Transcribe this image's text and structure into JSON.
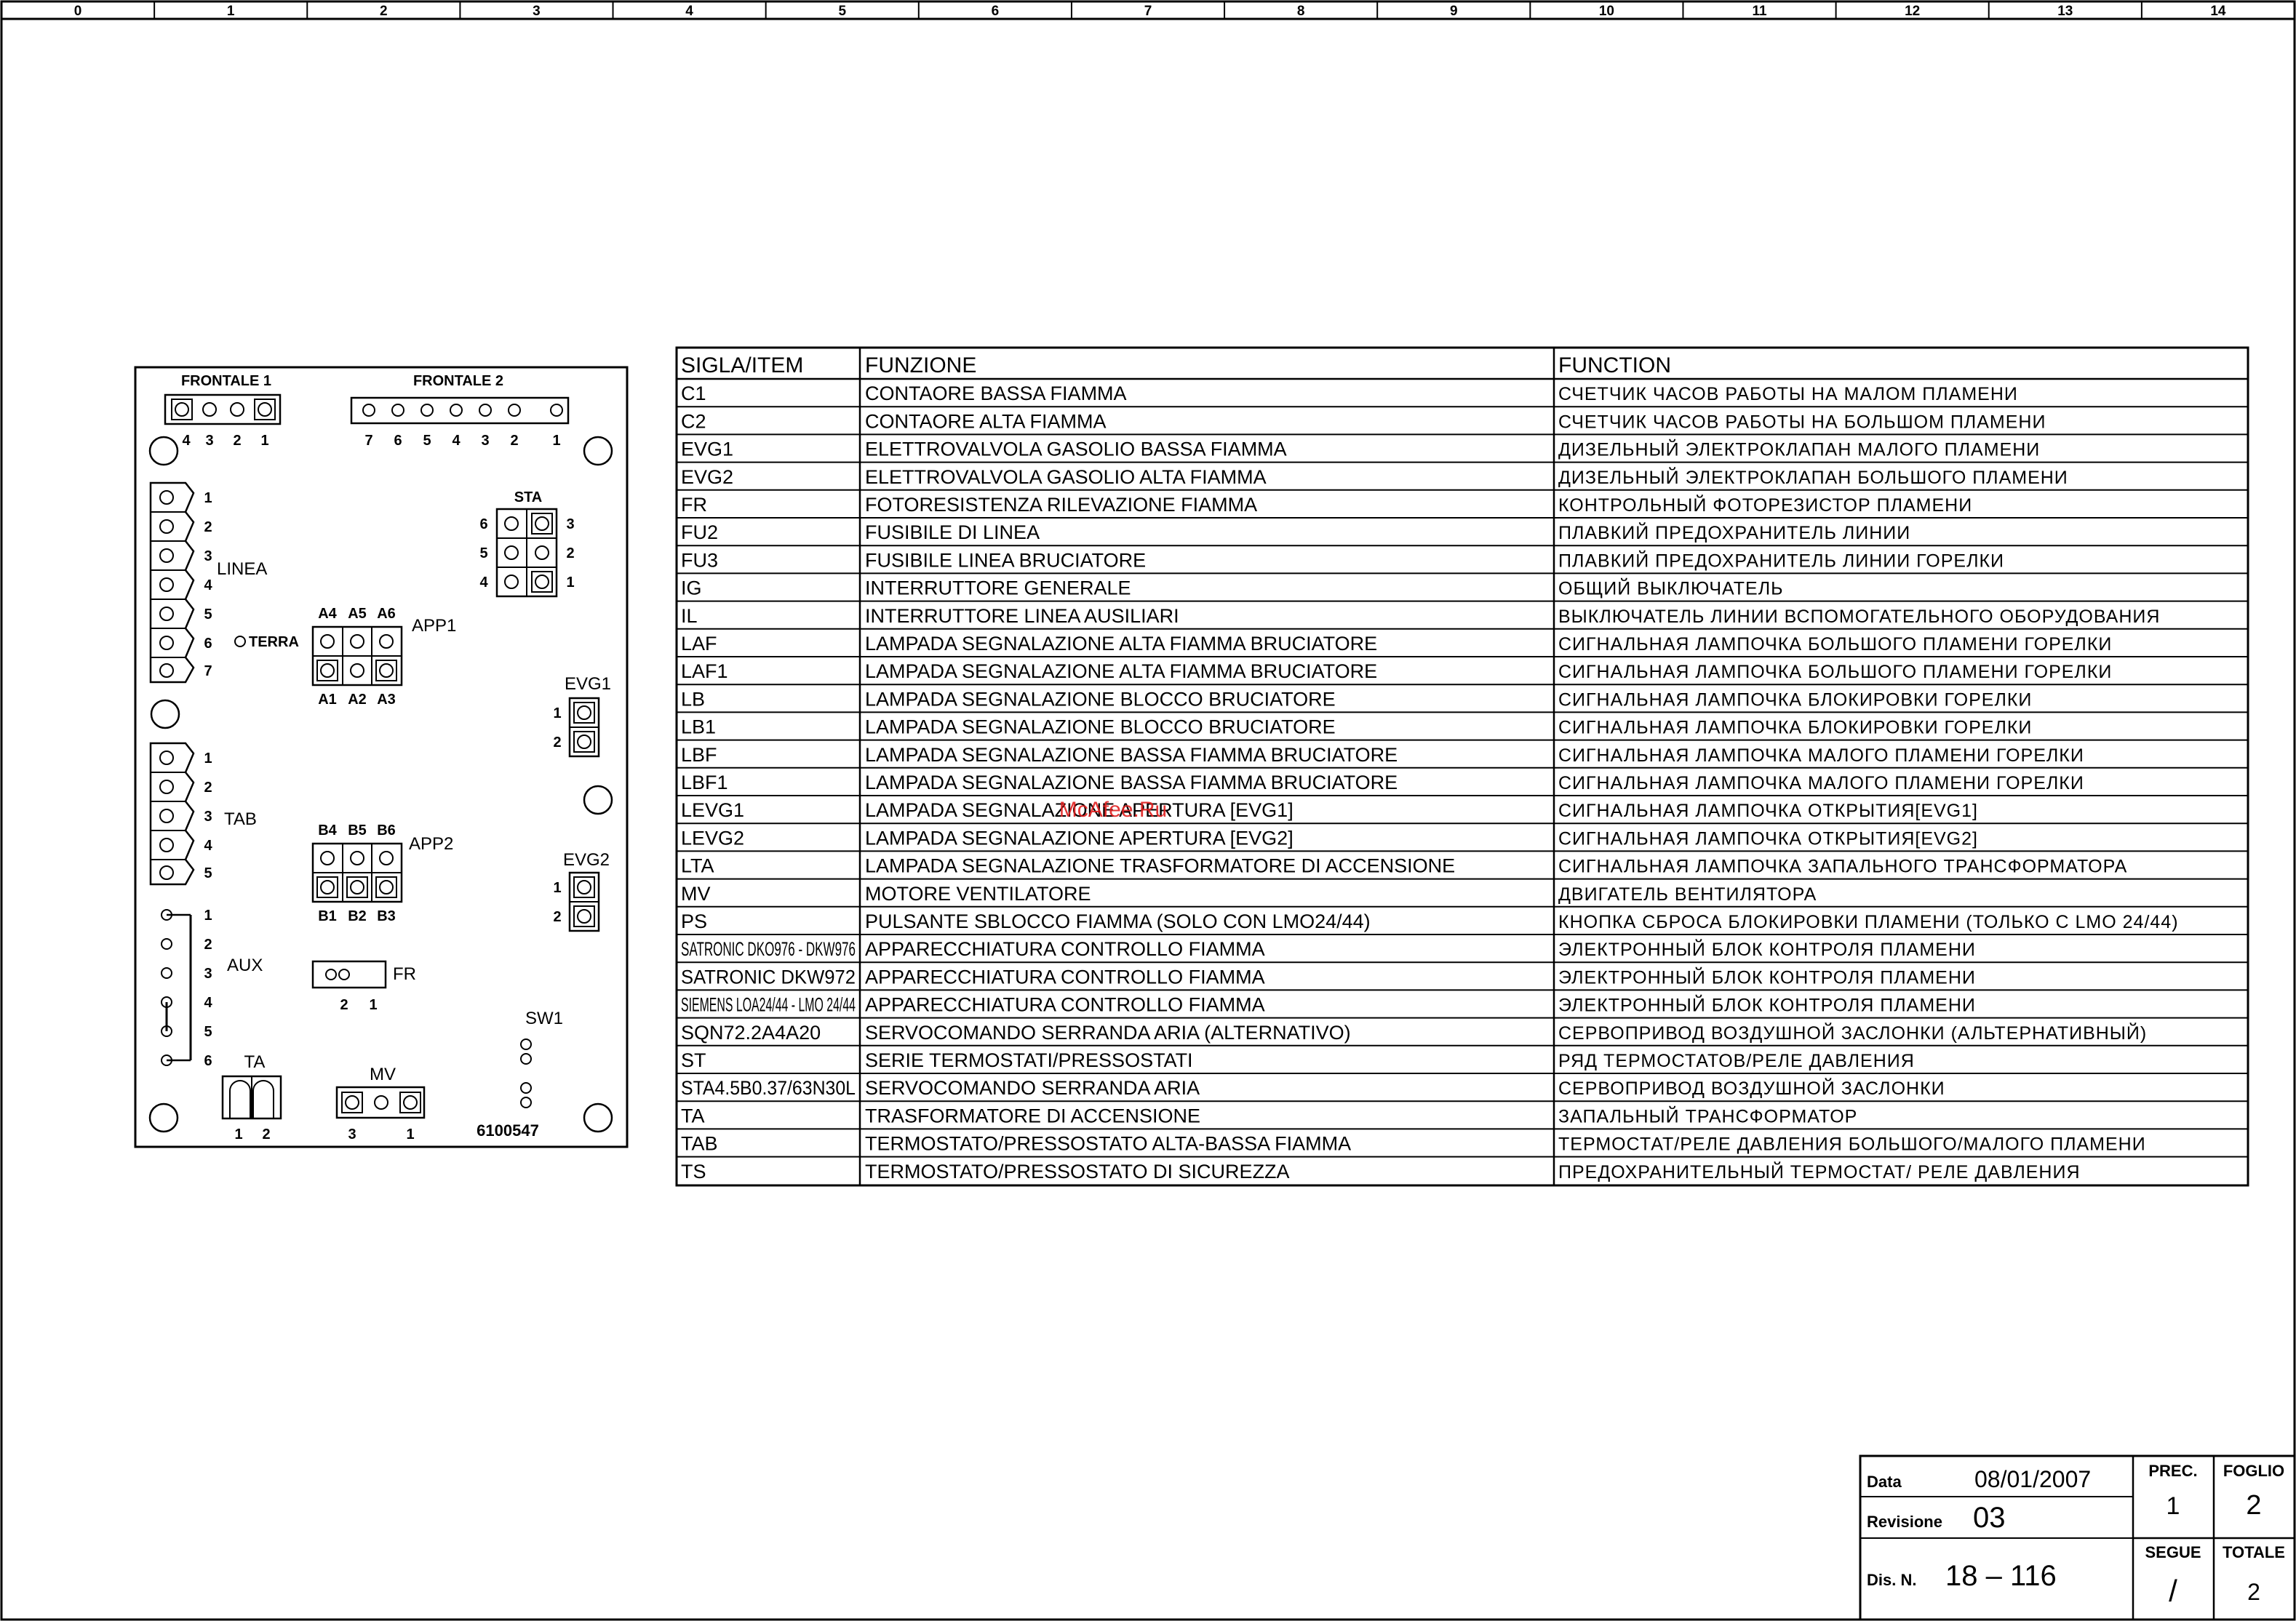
{
  "ruler": [
    "0",
    "1",
    "2",
    "3",
    "4",
    "5",
    "6",
    "7",
    "8",
    "9",
    "10",
    "11",
    "12",
    "13",
    "14"
  ],
  "board": {
    "frontale1": {
      "label": "FRONTALE 1",
      "pins": [
        "4",
        "3",
        "2",
        "1"
      ]
    },
    "frontale2": {
      "label": "FRONTALE 2",
      "pins": [
        "7",
        "6",
        "5",
        "4",
        "3",
        "2",
        "1"
      ]
    },
    "sta": {
      "label": "STA",
      "left_pins": [
        "6",
        "5",
        "4"
      ],
      "right_pins": [
        "3",
        "2",
        "1"
      ]
    },
    "linea": {
      "label": "LINEA",
      "pins": [
        "1",
        "2",
        "3",
        "4",
        "5",
        "6",
        "7"
      ],
      "terra": "TERRA"
    },
    "app1": {
      "label": "APP1",
      "top": [
        "A4",
        "A5",
        "A6"
      ],
      "bottom": [
        "A1",
        "A2",
        "A3"
      ]
    },
    "evg1": {
      "label": "EVG1",
      "pins": [
        "1",
        "2"
      ]
    },
    "tab": {
      "label": "TAB",
      "pins": [
        "1",
        "2",
        "3",
        "4",
        "5"
      ]
    },
    "app2": {
      "label": "APP2",
      "top": [
        "B4",
        "B5",
        "B6"
      ],
      "bottom": [
        "B1",
        "B2",
        "B3"
      ]
    },
    "evg2": {
      "label": "EVG2",
      "pins": [
        "1",
        "2"
      ]
    },
    "aux": {
      "label": "AUX",
      "pins": [
        "1",
        "2",
        "3",
        "4",
        "5",
        "6"
      ]
    },
    "fr": {
      "label": "FR",
      "pins": [
        "2",
        "1"
      ]
    },
    "sw1": {
      "label": "SW1"
    },
    "ta": {
      "label": "TA",
      "pins": [
        "1",
        "2"
      ]
    },
    "mv": {
      "label": "MV",
      "pins": [
        "3",
        "1"
      ]
    },
    "code": "6100547"
  },
  "table": {
    "headers": [
      "SIGLA/ITEM",
      "FUNZIONE",
      "FUNCTION"
    ],
    "rows": [
      [
        "C1",
        "CONTAORE BASSA FIAMMA",
        "СЧЕТЧИК ЧАСОВ РАБОТЫ НА МАЛОМ ПЛАМЕНИ"
      ],
      [
        "C2",
        "CONTAORE ALTA FIAMMA",
        "СЧЕТЧИК ЧАСОВ РАБОТЫ НА БОЛЬШОМ ПЛАМЕНИ"
      ],
      [
        "EVG1",
        "ELETTROVALVOLA GASOLIO BASSA FIAMMA",
        "ДИЗЕЛЬНЫЙ ЭЛЕКТРОКЛАПАН МАЛОГО ПЛАМЕНИ"
      ],
      [
        "EVG2",
        "ELETTROVALVOLA GASOLIO ALTA FIAMMA",
        "ДИЗЕЛЬНЫЙ ЭЛЕКТРОКЛАПАН БОЛЬШОГО ПЛАМЕНИ"
      ],
      [
        "FR",
        "FOTORESISTENZA RILEVAZIONE FIAMMA",
        "КОНТРОЛЬНЫЙ ФОТОРЕЗИСТОР ПЛАМЕНИ"
      ],
      [
        "FU2",
        "FUSIBILE DI LINEA",
        "ПЛАВКИЙ ПРЕДОХРАНИТЕЛЬ ЛИНИИ"
      ],
      [
        "FU3",
        "FUSIBILE LINEA BRUCIATORE",
        "ПЛАВКИЙ ПРЕДОХРАНИТЕЛЬ ЛИНИИ ГОРЕЛКИ"
      ],
      [
        "IG",
        "INTERRUTTORE GENERALE",
        "ОБЩИЙ ВЫКЛЮЧАТЕЛЬ"
      ],
      [
        "IL",
        "INTERRUTTORE LINEA AUSILIARI",
        "ВЫКЛЮЧАТЕЛЬ ЛИНИИ ВСПОМОГАТЕЛЬНОГО ОБОРУДОВАНИЯ"
      ],
      [
        "LAF",
        "LAMPADA SEGNALAZIONE ALTA FIAMMA BRUCIATORE",
        "СИГНАЛЬНАЯ ЛАМПОЧКА БОЛЬШОГО ПЛАМЕНИ ГОРЕЛКИ"
      ],
      [
        "LAF1",
        "LAMPADA SEGNALAZIONE ALTA FIAMMA BRUCIATORE",
        "СИГНАЛЬНАЯ ЛАМПОЧКА БОЛЬШОГО ПЛАМЕНИ ГОРЕЛКИ"
      ],
      [
        "LB",
        "LAMPADA SEGNALAZIONE BLOCCO BRUCIATORE",
        "СИГНАЛЬНАЯ ЛАМПОЧКА  БЛОКИРОВКИ ГОРЕЛКИ"
      ],
      [
        "LB1",
        "LAMPADA SEGNALAZIONE BLOCCO BRUCIATORE",
        "СИГНАЛЬНАЯ ЛАМПОЧКА  БЛОКИРОВКИ ГОРЕЛКИ"
      ],
      [
        "LBF",
        "LAMPADA SEGNALAZIONE BASSA FIAMMA BRUCIATORE",
        "СИГНАЛЬНАЯ ЛАМПОЧКА МАЛОГО ПЛАМЕНИ ГОРЕЛКИ"
      ],
      [
        "LBF1",
        "LAMPADA SEGNALAZIONE BASSA FIAMMA BRUCIATORE",
        "СИГНАЛЬНАЯ ЛАМПОЧКА МАЛОГО ПЛАМЕНИ ГОРЕЛКИ"
      ],
      [
        "LEVG1",
        "LAMPADA SEGNALAZIONE APERTURA [EVG1]",
        "СИГНАЛЬНАЯ ЛАМПОЧКА ОТКРЫТИЯ[EVG1]"
      ],
      [
        "LEVG2",
        "LAMPADA SEGNALAZIONE APERTURA [EVG2]",
        "СИГНАЛЬНАЯ ЛАМПОЧКА ОТКРЫТИЯ[EVG2]"
      ],
      [
        "LTA",
        "LAMPADA SEGNALAZIONE TRASFORMATORE DI ACCENSIONE",
        "СИГНАЛЬНАЯ ЛАМПОЧКА ЗАПАЛЬНОГО ТРАНСФОРМАТОРА"
      ],
      [
        "MV",
        "MOTORE VENTILATORE",
        "ДВИГАТЕЛЬ ВЕНТИЛЯТОРА"
      ],
      [
        "PS",
        "PULSANTE SBLOCCO FIAMMA (SOLO CON LMO24/44)",
        "КНОПКА СБРОСА БЛОКИРОВКИ ПЛАМЕНИ (ТОЛЬКО С LMO 24/44)"
      ],
      [
        "SATRONIC DKO976 - DKW976",
        "APPARECCHIATURA CONTROLLO FIAMMA",
        "ЭЛЕКТРОННЫЙ БЛОК КОНТРОЛЯ ПЛАМЕНИ"
      ],
      [
        "SATRONIC DKW972",
        "APPARECCHIATURA CONTROLLO FIAMMA",
        "ЭЛЕКТРОННЫЙ БЛОК КОНТРОЛЯ ПЛАМЕНИ"
      ],
      [
        "SIEMENS LOA24/44 - LMO 24/44",
        "APPARECCHIATURA CONTROLLO FIAMMA",
        "ЭЛЕКТРОННЫЙ БЛОК КОНТРОЛЯ ПЛАМЕНИ"
      ],
      [
        "SQN72.2A4A20",
        "SERVOCOMANDO SERRANDA ARIA (ALTERNATIVO)",
        "СЕРВОПРИВОД  ВОЗДУШНОЙ ЗАСЛОНКИ (АЛЬТЕРНАТИВНЫЙ)"
      ],
      [
        "ST",
        "SERIE TERMOSTATI/PRESSOSTATI",
        "РЯД ТЕРМОСТАТОВ/РЕЛЕ ДАВЛЕНИЯ"
      ],
      [
        "STA4.5B0.37/63N30L",
        "SERVOCOMANDO SERRANDA ARIA",
        "СЕРВОПРИВОД  ВОЗДУШНОЙ ЗАСЛОНКИ"
      ],
      [
        "TA",
        "TRASFORMATORE DI ACCENSIONE",
        "ЗАПАЛЬНЫЙ ТРАНСФОРМАТОР"
      ],
      [
        "TAB",
        "TERMOSTATO/PRESSOSTATO ALTA-BASSA FIAMMA",
        "ТЕРМОСТАТ/РЕЛЕ ДАВЛЕНИЯ БОЛЬШОГО/МАЛОГО ПЛАМЕНИ"
      ],
      [
        "TS",
        "TERMOSTATO/PRESSOSTATO DI SICUREZZA",
        "ПРЕДОХРАНИТЕЛЬНЫЙ ТЕРМОСТАТ/ РЕЛЕ ДАВЛЕНИЯ"
      ]
    ]
  },
  "watermark": "McAfee.Ru",
  "watermark_color": "#e02020",
  "title_block": {
    "data_label": "Data",
    "data_value": "08/01/2007",
    "revisione_label": "Revisione",
    "revisione_value": "03",
    "dis_label": "Dis. N.",
    "dis_value": "18 – 116",
    "prec_label": "PREC.",
    "prec_value": "1",
    "foglio_label": "FOGLIO",
    "foglio_value": "2",
    "segue_label": "SEGUE",
    "segue_value": "/",
    "totale_label": "TOTALE",
    "totale_value": "2"
  }
}
